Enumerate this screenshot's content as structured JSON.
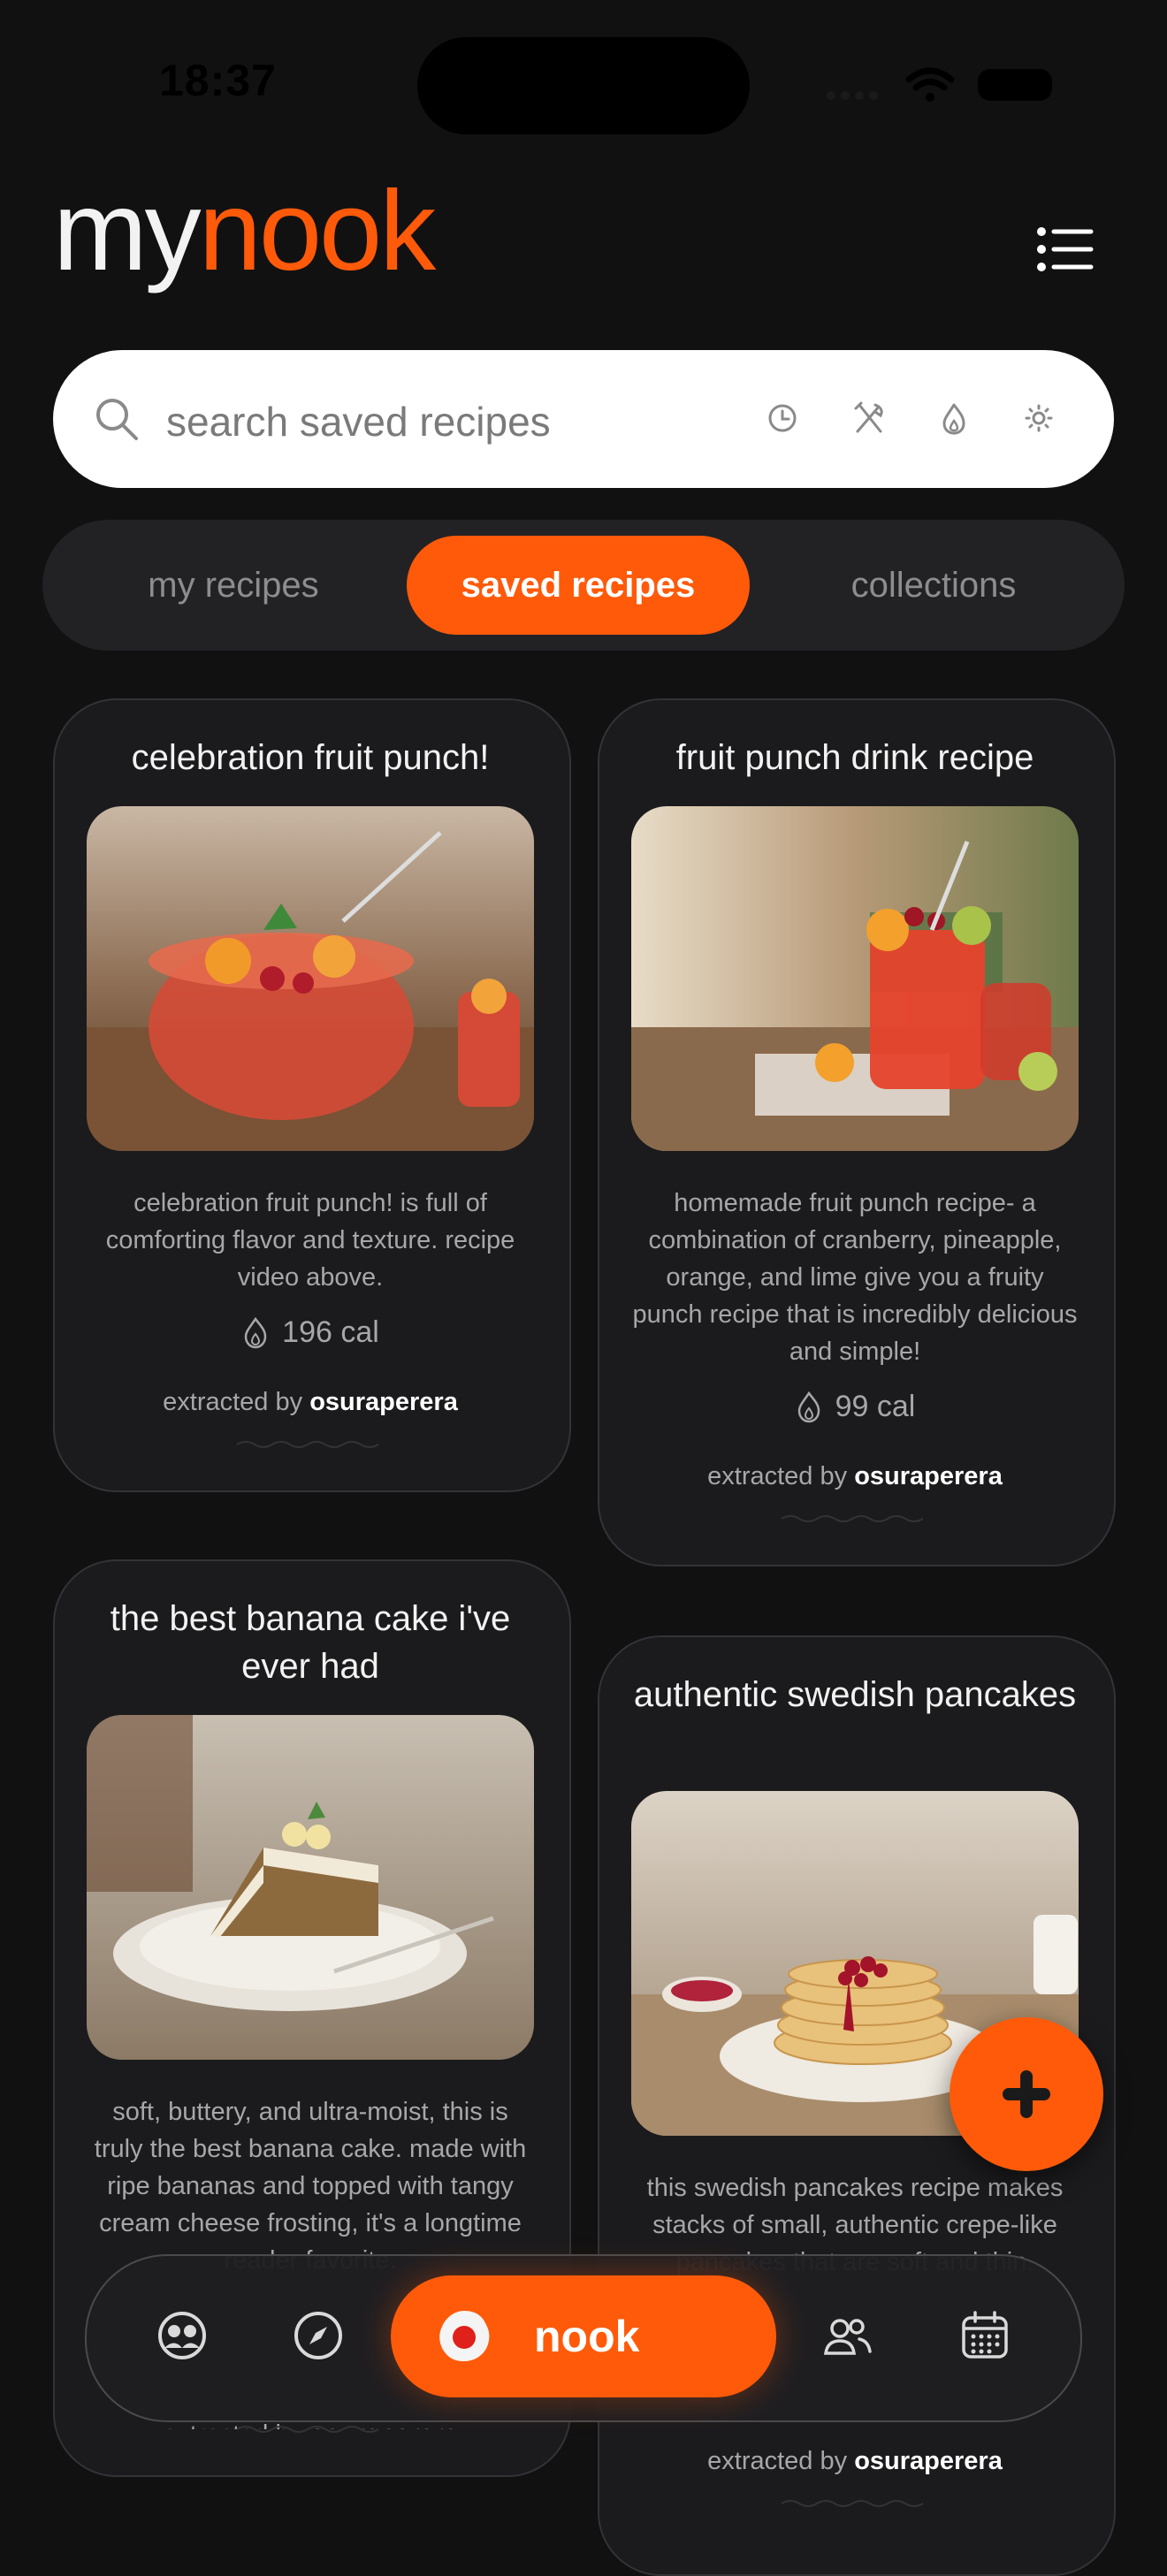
{
  "status_bar": {
    "time": "18:37"
  },
  "header": {
    "logo_my": "my",
    "logo_nook": "nook"
  },
  "search": {
    "placeholder": "search saved recipes",
    "value": ""
  },
  "filters": [
    "clock-icon",
    "utensils-icon",
    "flame-icon",
    "sun-icon"
  ],
  "tabs": [
    {
      "label": "my recipes",
      "active": false
    },
    {
      "label": "saved recipes",
      "active": true
    },
    {
      "label": "collections",
      "active": false
    }
  ],
  "recipes": [
    {
      "title": "celebration fruit punch!",
      "description": "celebration fruit punch! is full of comforting flavor and texture. recipe video above.",
      "calories": "196 cal",
      "extracted_prefix": "extracted by",
      "author": "osuraperera"
    },
    {
      "title": "fruit punch drink recipe",
      "description": "homemade fruit punch recipe- a combination of cranberry, pineapple, orange, and lime give you a fruity punch recipe that is incredibly delicious and simple!",
      "calories": "99 cal",
      "extracted_prefix": "extracted by",
      "author": "osuraperera"
    },
    {
      "title": "the best banana cake i've ever had",
      "description": "soft, buttery, and ultra-moist, this is truly the best banana cake. made with ripe bananas and topped with tangy cream cheese frosting, it's a longtime reader favorite.",
      "calories": "",
      "extracted_prefix": "extracted by",
      "author": "osuraperera"
    },
    {
      "title": "authentic swedish pancakes",
      "description": "this swedish pancakes recipe makes stacks of small, authentic crepe-like pancakes that are soft and thin.",
      "calories": "",
      "extracted_prefix": "extracted by",
      "author": "osuraperera"
    }
  ],
  "bottom_nav": {
    "center_label": "nook",
    "items": [
      "faces-icon",
      "compass-icon",
      "nook-logo-icon",
      "people-icon",
      "calendar-icon"
    ]
  },
  "colors": {
    "accent": "#ff5a0a",
    "background": "#111112",
    "card": "#1b1b1d"
  }
}
